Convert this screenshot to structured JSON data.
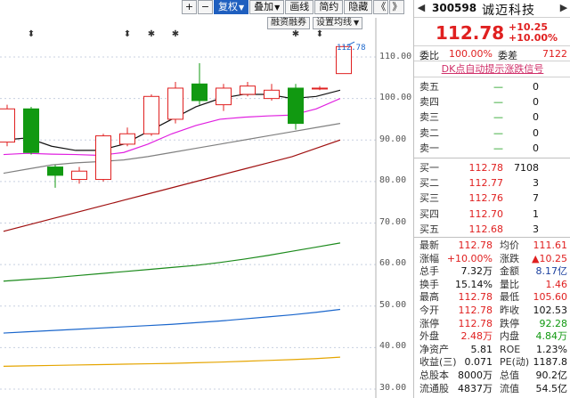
{
  "toolbar": {
    "plus": "+",
    "minus": "−",
    "fuquan": "复权",
    "diejia": "叠加",
    "huaxian": "画线",
    "jianyue": "简约",
    "yincang": "隐藏",
    "prev": "《",
    "next": "》",
    "caret": "▼"
  },
  "subbar": {
    "margin": "融资融券",
    "ma_settings": "设置均线",
    "caret": "▼"
  },
  "axis": {
    "ticks": [
      "110.00",
      "100.00",
      "90.00",
      "80.00",
      "70.00",
      "60.00",
      "50.00",
      "40.00",
      "30.00"
    ],
    "last_tag": "112.78"
  },
  "colors": {
    "up": "#e02020",
    "down": "#119911",
    "ma5": "#111111",
    "ma10": "#e020e0",
    "ma20": "#808080",
    "ma60": "#a01010",
    "ma120": "#1b8a1b",
    "ma250": "#1a66cc",
    "ma_extra": "#e5a500"
  },
  "chart_data": {
    "type": "candlestick",
    "yaxis_ticks": [
      110,
      100,
      90,
      80,
      70,
      60,
      50,
      40,
      30
    ],
    "ylim": [
      28.5,
      116
    ],
    "last_price_tag": 112.78,
    "candles": [
      {
        "o": 89.5,
        "c": 97.5,
        "h": 98.5,
        "l": 88.5
      },
      {
        "o": 97.5,
        "c": 87.0,
        "h": 98.0,
        "l": 86.5
      },
      {
        "o": 83.5,
        "c": 81.5,
        "h": 84.0,
        "l": 78.5
      },
      {
        "o": 80.5,
        "c": 82.5,
        "h": 83.5,
        "l": 79.5
      },
      {
        "o": 80.5,
        "c": 91.0,
        "h": 91.5,
        "l": 80.0
      },
      {
        "o": 89.0,
        "c": 91.5,
        "h": 93.0,
        "l": 88.5
      },
      {
        "o": 91.5,
        "c": 100.5,
        "h": 101.0,
        "l": 91.0
      },
      {
        "o": 95.0,
        "c": 102.5,
        "h": 104.0,
        "l": 94.0
      },
      {
        "o": 103.5,
        "c": 99.5,
        "h": 108.5,
        "l": 98.5
      },
      {
        "o": 98.5,
        "c": 102.5,
        "h": 103.5,
        "l": 97.0
      },
      {
        "o": 101.0,
        "c": 103.0,
        "h": 104.0,
        "l": 100.5
      },
      {
        "o": 100.0,
        "c": 102.0,
        "h": 103.5,
        "l": 99.5
      },
      {
        "o": 102.5,
        "c": 94.0,
        "h": 103.5,
        "l": 92.5
      },
      {
        "o": 102.5,
        "c": 102.5,
        "h": 103.0,
        "l": 102.0
      },
      {
        "o": 106.0,
        "c": 112.5,
        "h": 112.78,
        "l": 106.0
      }
    ],
    "ma_lines": [
      {
        "key": "ma5",
        "values": [
          90,
          90.5,
          88.5,
          87.5,
          87.5,
          89,
          92,
          95,
          98,
          100,
          101,
          101,
          100,
          100.5,
          102
        ]
      },
      {
        "key": "ma10",
        "values": [
          86.5,
          86.8,
          86.6,
          86.5,
          86.3,
          87,
          89,
          91.5,
          93.5,
          95,
          95.5,
          95.8,
          96,
          97.5,
          100
        ]
      },
      {
        "key": "ma20",
        "values": [
          82,
          83,
          84,
          84.5,
          84.8,
          85.2,
          86,
          87,
          88,
          89,
          90,
          91,
          92,
          93,
          94
        ]
      },
      {
        "key": "ma60",
        "values": [
          68,
          69.5,
          71,
          72.5,
          74,
          75.5,
          77,
          78.5,
          80,
          81.5,
          83,
          84.5,
          86,
          88,
          90
        ]
      },
      {
        "key": "ma120",
        "values": [
          56,
          56.4,
          56.8,
          57.3,
          57.8,
          58.3,
          58.8,
          59.3,
          59.8,
          60.5,
          61.3,
          62.2,
          63.2,
          64.2,
          65.2
        ]
      },
      {
        "key": "ma250",
        "values": [
          43.5,
          43.8,
          44.1,
          44.4,
          44.7,
          45,
          45.3,
          45.6,
          46,
          46.4,
          46.9,
          47.4,
          47.9,
          48.5,
          49.2
        ]
      },
      {
        "key": "ma_extra",
        "values": [
          35.5,
          35.6,
          35.7,
          35.8,
          35.9,
          36,
          36.1,
          36.2,
          36.35,
          36.5,
          36.7,
          36.9,
          37.1,
          37.35,
          37.7
        ]
      }
    ],
    "event_markers": [
      {
        "index": 1,
        "symbol": "⬍"
      },
      {
        "index": 5,
        "symbol": "⬍"
      },
      {
        "index": 6,
        "symbol": "✱"
      },
      {
        "index": 7,
        "symbol": "✱"
      },
      {
        "index": 12,
        "symbol": "✱"
      },
      {
        "index": 13,
        "symbol": "⬍"
      }
    ]
  },
  "header": {
    "prev_arrow": "◀",
    "next_arrow": "▶",
    "code": "300598",
    "name": "诚迈科技"
  },
  "quote": {
    "price": "112.78",
    "change": "+10.25",
    "change_pct": "+10.00%"
  },
  "weibi": {
    "label1": "委比",
    "value1": "100.00%",
    "label2": "委差",
    "value2": "7122"
  },
  "signal": "DK点自动提示涨跌信号",
  "asks": [
    {
      "label": "卖五",
      "price": "—",
      "vol": "0"
    },
    {
      "label": "卖四",
      "price": "—",
      "vol": "0"
    },
    {
      "label": "卖三",
      "price": "—",
      "vol": "0"
    },
    {
      "label": "卖二",
      "price": "—",
      "vol": "0"
    },
    {
      "label": "卖一",
      "price": "—",
      "vol": "0"
    }
  ],
  "bids": [
    {
      "label": "买一",
      "price": "112.78",
      "vol": "7108"
    },
    {
      "label": "买二",
      "price": "112.77",
      "vol": "3"
    },
    {
      "label": "买三",
      "price": "112.76",
      "vol": "7"
    },
    {
      "label": "买四",
      "price": "112.70",
      "vol": "1"
    },
    {
      "label": "买五",
      "price": "112.68",
      "vol": "3"
    }
  ],
  "stats": [
    {
      "l1": "最新",
      "v1": "112.78",
      "c1": "red",
      "l2": "均价",
      "v2": "111.61",
      "c2": "red"
    },
    {
      "l1": "涨幅",
      "v1": "+10.00%",
      "c1": "red",
      "l2": "涨跌",
      "v2": "▲10.25",
      "c2": "red"
    },
    {
      "l1": "总手",
      "v1": "7.32万",
      "c1": "dark",
      "l2": "金额",
      "v2": "8.17亿",
      "c2": "blue"
    },
    {
      "l1": "换手",
      "v1": "15.14%",
      "c1": "dark",
      "l2": "量比",
      "v2": "1.46",
      "c2": "red"
    },
    {
      "l1": "最高",
      "v1": "112.78",
      "c1": "red",
      "l2": "最低",
      "v2": "105.60",
      "c2": "red"
    },
    {
      "l1": "今开",
      "v1": "112.78",
      "c1": "red",
      "l2": "昨收",
      "v2": "102.53",
      "c2": "dark"
    },
    {
      "l1": "涨停",
      "v1": "112.78",
      "c1": "red",
      "l2": "跌停",
      "v2": "92.28",
      "c2": "green"
    },
    {
      "l1": "外盘",
      "v1": "2.48万",
      "c1": "red",
      "l2": "内盘",
      "v2": "4.84万",
      "c2": "green"
    },
    {
      "l1": "净资产",
      "v1": "5.81",
      "c1": "dark",
      "l2": "ROE",
      "v2": "1.23%",
      "c2": "dark"
    },
    {
      "l1": "收益(三)",
      "v1": "0.071",
      "c1": "dark",
      "l2": "PE(动)",
      "v2": "1187.8",
      "c2": "dark"
    },
    {
      "l1": "总股本",
      "v1": "8000万",
      "c1": "dark",
      "l2": "总值",
      "v2": "90.2亿",
      "c2": "dark"
    },
    {
      "l1": "流通股",
      "v1": "4837万",
      "c1": "dark",
      "l2": "流值",
      "v2": "54.5亿",
      "c2": "dark"
    }
  ]
}
